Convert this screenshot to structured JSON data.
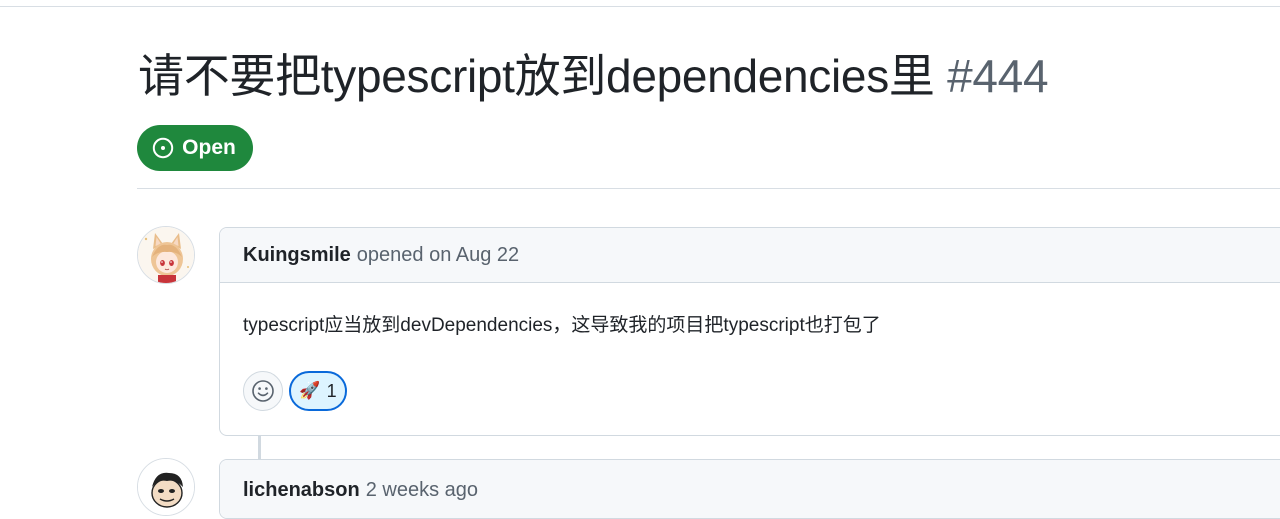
{
  "issue": {
    "title": "请不要把typescript放到dependencies里",
    "number": "#444",
    "state": "Open"
  },
  "comments": [
    {
      "author": "Kuingsmile",
      "meta": "opened on Aug 22",
      "body": "typescript应当放到devDependencies，这导致我的项目把typescript也打包了",
      "reactions": [
        {
          "emoji": "🚀",
          "icon": "rocket-emoji",
          "count": "1"
        }
      ]
    },
    {
      "author": "lichenabson",
      "meta": "2 weeks ago"
    }
  ],
  "colors": {
    "open_green": "#1f883d",
    "reaction_blue": "#0969da",
    "reaction_bg": "#ddf4ff",
    "muted_text": "#59636e"
  },
  "icons": {
    "state": "issue-opened-icon",
    "add_reaction": "smiley-icon"
  }
}
